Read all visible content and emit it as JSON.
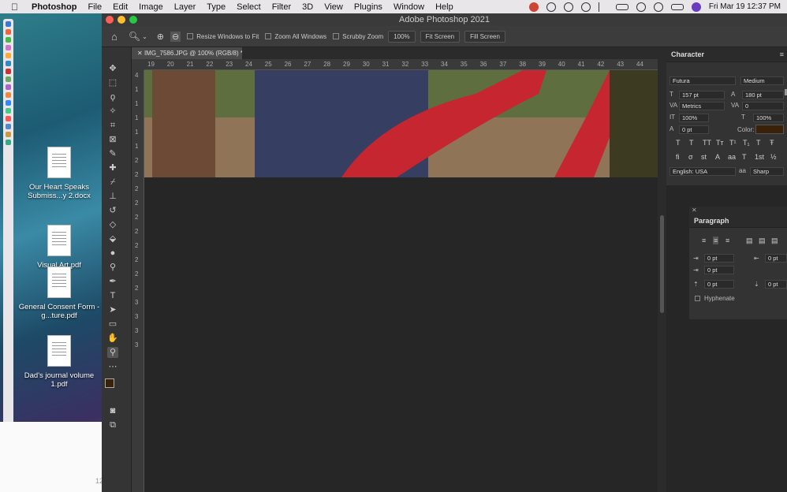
{
  "menubar": {
    "apple": "",
    "app": "Photoshop",
    "items": [
      "File",
      "Edit",
      "Image",
      "Layer",
      "Type",
      "Select",
      "Filter",
      "3D",
      "View",
      "Plugins",
      "Window",
      "Help"
    ],
    "clock": "Fri Mar 19  12:37 PM"
  },
  "desktop": {
    "files": [
      {
        "name": "Our Heart Speaks Submiss...y 2.docx"
      },
      {
        "name": "Visual Art.pdf"
      },
      {
        "name": "General Consent Form - g...ture.pdf"
      },
      {
        "name": "Dad's journal volume 1.pdf"
      }
    ],
    "bottom_num": "12"
  },
  "window": {
    "title": "Adobe Photoshop 2021"
  },
  "options": {
    "resize_label": "Resize Windows to Fit",
    "zoom_all_label": "Zoom All Windows",
    "scrubby_label": "Scrubby Zoom",
    "zoom_value": "100%",
    "fit_screen": "Fit Screen",
    "fill_screen": "Fill Screen"
  },
  "document": {
    "tab_title": "IMG_7586.JPG @ 100% (RGB/8) *"
  },
  "rulers": {
    "h": [
      "19",
      "20",
      "21",
      "22",
      "23",
      "24",
      "25",
      "26",
      "27",
      "28",
      "29",
      "30",
      "31",
      "32",
      "33",
      "34",
      "35",
      "36",
      "37",
      "38",
      "39",
      "40",
      "41",
      "42",
      "43",
      "44"
    ],
    "v": [
      "4",
      "1",
      "1",
      "1",
      "1",
      "1",
      "2",
      "2",
      "2",
      "2",
      "2",
      "2",
      "2",
      "2",
      "2",
      "2",
      "3",
      "3",
      "3",
      "3"
    ]
  },
  "character": {
    "title": "Character",
    "font": "Futura",
    "style": "Medium",
    "size": "157 pt",
    "leading": "180 pt",
    "kerning": "Metrics",
    "tracking": "0",
    "vscale": "100%",
    "hscale": "100%",
    "baseline": "0 pt",
    "color_label": "Color:",
    "color": "#3a2208",
    "language": "English: USA",
    "antialias": "Sharp",
    "aa_label": "aa"
  },
  "paragraph": {
    "title": "Paragraph",
    "indent_left": "0 pt",
    "indent_right": "0 pt",
    "first_line": "0 pt",
    "space_before": "0 pt",
    "space_after": "0 pt",
    "hyphenate": "Hyphenate"
  }
}
